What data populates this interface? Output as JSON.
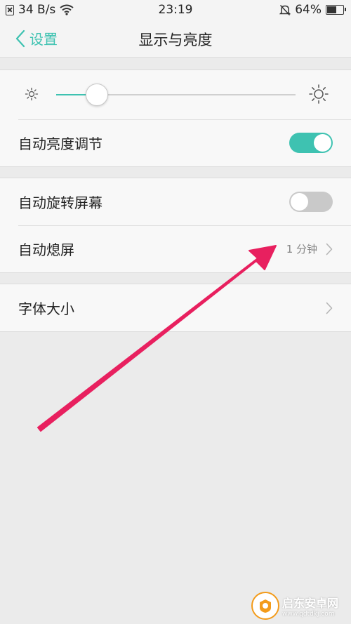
{
  "status_bar": {
    "speed": "34 B/s",
    "time": "23:19",
    "battery": "64%",
    "battery_level": 0.64,
    "icons": [
      "sim-off-icon",
      "wifi-icon",
      "mute-bell-icon",
      "battery-icon"
    ]
  },
  "header": {
    "back_label": "设置",
    "title": "显示与亮度"
  },
  "brightness": {
    "level": 0.17,
    "auto_label": "自动亮度调节",
    "auto_on": true
  },
  "group2": {
    "rotate_label": "自动旋转屏幕",
    "rotate_on": false,
    "sleep_label": "自动熄屏",
    "sleep_value": "1 分钟"
  },
  "group3": {
    "font_label": "字体大小"
  },
  "colors": {
    "accent": "#3ec2b1",
    "annotation_arrow": "#e8205f",
    "toggle_off": "#c9c9c9"
  },
  "watermark": {
    "name": "启东安卓网",
    "url": "www.qdtdkj.com"
  }
}
